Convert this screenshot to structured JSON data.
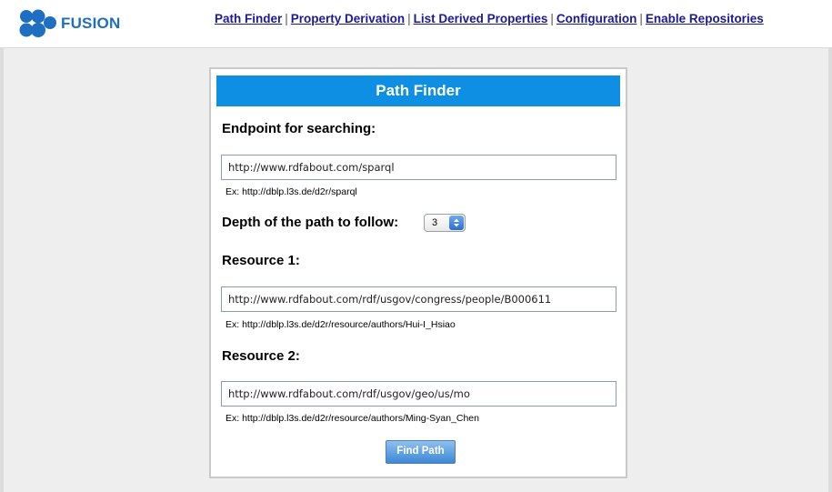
{
  "header": {
    "logo_text": "FUSION",
    "nav": [
      {
        "label": "Path Finder"
      },
      {
        "label": "Property Derivation"
      },
      {
        "label": "List Derived Properties"
      },
      {
        "label": "Configuration"
      },
      {
        "label": "Enable Repositories"
      }
    ],
    "separator": "|"
  },
  "panel": {
    "title": "Path Finder",
    "endpoint": {
      "label": "Endpoint for searching:",
      "value": "http://www.rdfabout.com/sparql",
      "example": "Ex: http://dblp.l3s.de/d2r/sparql"
    },
    "depth": {
      "label": "Depth of the path to follow:",
      "selected": "3"
    },
    "resource1": {
      "label": "Resource 1:",
      "value": "http://www.rdfabout.com/rdf/usgov/congress/people/B000611",
      "example": "Ex: http://dblp.l3s.de/d2r/resource/authors/Hui-I_Hsiao"
    },
    "resource2": {
      "label": "Resource 2:",
      "value": "http://www.rdfabout.com/rdf/usgov/geo/us/mo",
      "example": "Ex: http://dblp.l3s.de/d2r/resource/authors/Ming-Syan_Chen"
    },
    "submit_label": "Find Path"
  },
  "colors": {
    "brand_blue": "#1e6fc2",
    "title_bar": "#0f8fe3",
    "nav_link": "#1a1a99",
    "button": "#3d88d6"
  }
}
